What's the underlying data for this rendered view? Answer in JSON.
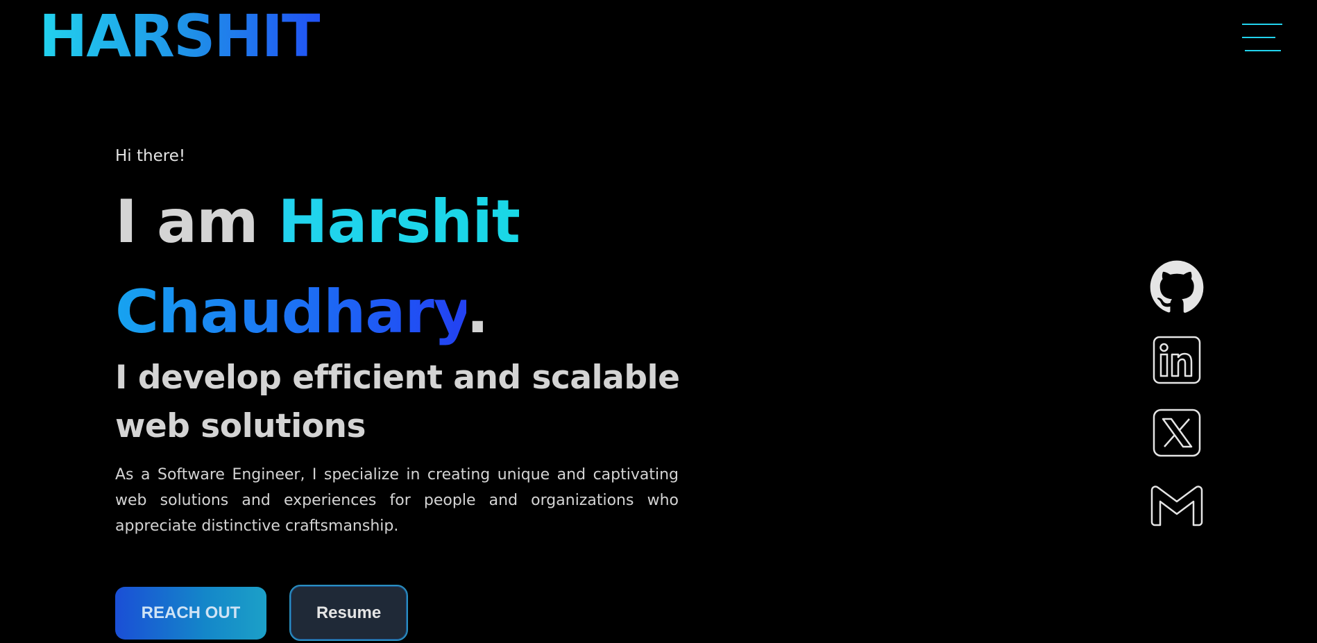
{
  "header": {
    "logo_text": "HARSHIT",
    "menu_icon": "hamburger-menu-icon"
  },
  "hero": {
    "greeting": "Hi there!",
    "headline_prefix": "I am ",
    "name_first": "Harshit",
    "name_last": "Chaudhary",
    "name_suffix": ".",
    "subheadline": "I develop efficient and scalable web solutions",
    "description": "As a Software Engineer, I specialize in creating unique and captivating web solutions and experiences for people and organizations who appreciate distinctive craftsmanship."
  },
  "buttons": {
    "reach_out_label": "REACH OUT",
    "resume_label": "Resume"
  },
  "social": {
    "icons": [
      "github-icon",
      "linkedin-icon",
      "x-twitter-icon",
      "gmail-icon"
    ]
  },
  "colors": {
    "background": "#000000",
    "accent_cyan": "#22d3ee",
    "accent_blue": "#2152f5",
    "text": "#d4d4d4"
  }
}
